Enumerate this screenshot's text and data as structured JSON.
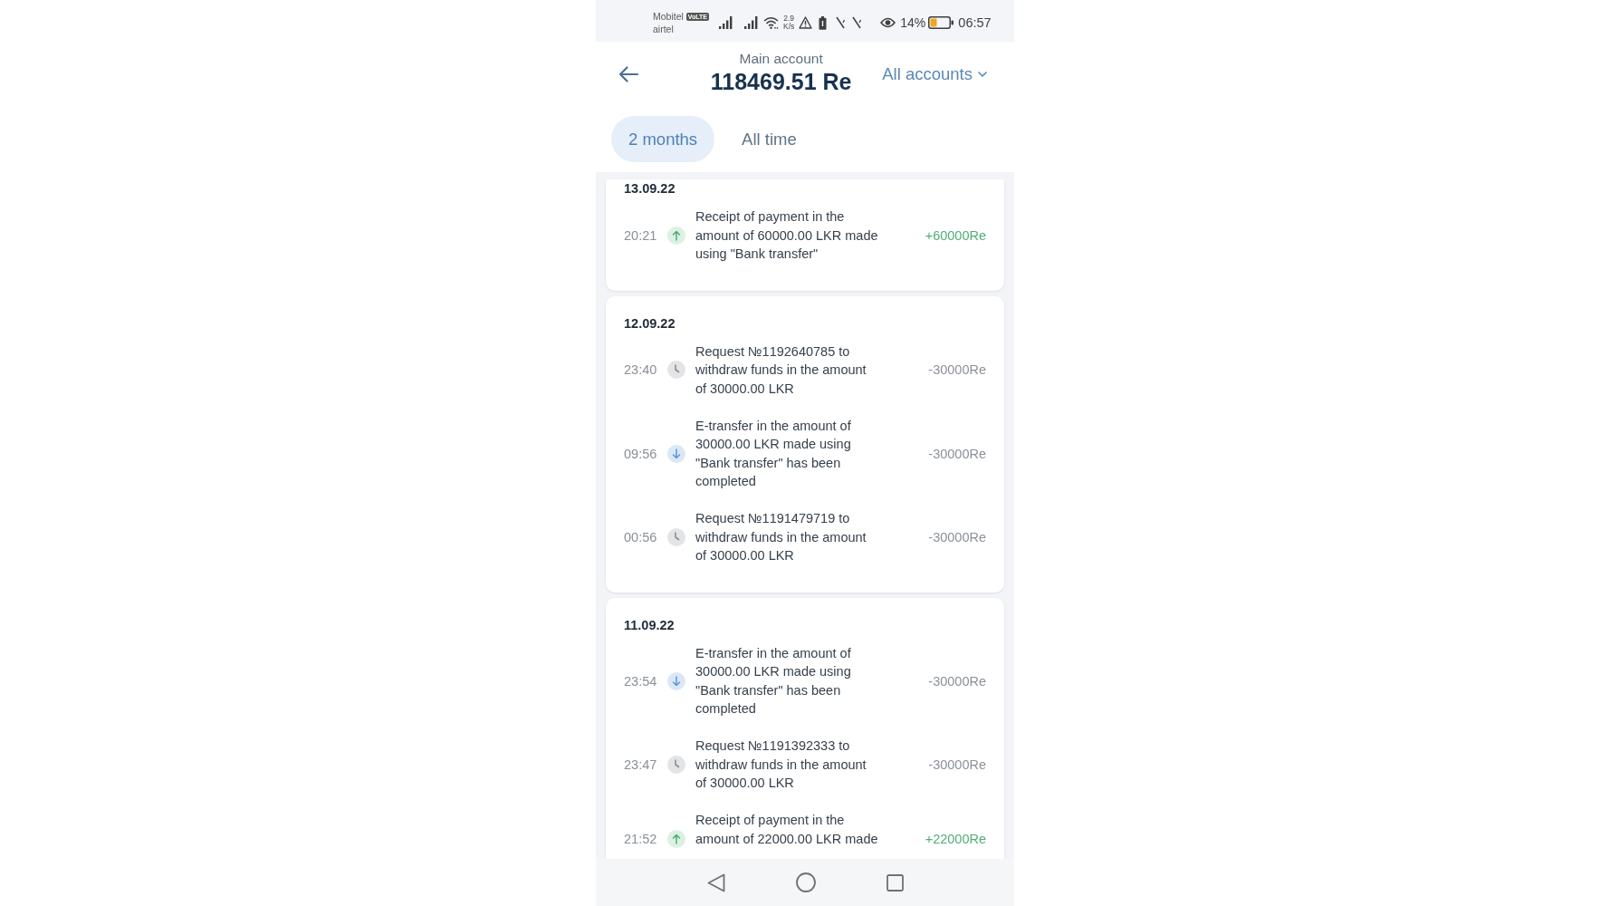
{
  "status_bar": {
    "carriers": [
      {
        "name": "Mobitel",
        "tag": "VoLTE"
      },
      {
        "name": "airtel"
      }
    ],
    "data_speed": {
      "value": "2.9",
      "unit": "K/s"
    },
    "battery": "14%",
    "time": "06:57"
  },
  "header": {
    "account_label": "Main account",
    "balance": "118469.51 Re",
    "account_selector": "All accounts"
  },
  "tabs": [
    {
      "label": "2 months",
      "selected": true
    },
    {
      "label": "All time",
      "selected": false
    }
  ],
  "days": [
    {
      "date": "13.09.22",
      "transactions": [
        {
          "time": "20:21",
          "kind": "receipt",
          "description": "Receipt of payment in the amount of 60000.00 LKR made using \"Bank transfer\"",
          "amount": "+60000Re"
        }
      ]
    },
    {
      "date": "12.09.22",
      "transactions": [
        {
          "time": "23:40",
          "kind": "pending",
          "description": "Request №1192640785 to withdraw funds in the amount of 30000.00 LKR",
          "amount": "-30000Re"
        },
        {
          "time": "09:56",
          "kind": "transfer",
          "description": "E-transfer in the amount of 30000.00 LKR made using \"Bank transfer\" has been completed",
          "amount": "-30000Re"
        },
        {
          "time": "00:56",
          "kind": "pending",
          "description": "Request №1191479719 to withdraw funds in the amount of 30000.00 LKR",
          "amount": "-30000Re"
        }
      ]
    },
    {
      "date": "11.09.22",
      "transactions": [
        {
          "time": "23:54",
          "kind": "transfer",
          "description": "E-transfer in the amount of 30000.00 LKR made using \"Bank transfer\" has been completed",
          "amount": "-30000Re"
        },
        {
          "time": "23:47",
          "kind": "pending",
          "description": "Request №1191392333 to withdraw funds in the amount of 30000.00 LKR",
          "amount": "-30000Re"
        },
        {
          "time": "21:52",
          "kind": "receipt",
          "description": "Receipt of payment in the amount of 22000.00 LKR made",
          "amount": "+22000Re"
        }
      ]
    }
  ]
}
